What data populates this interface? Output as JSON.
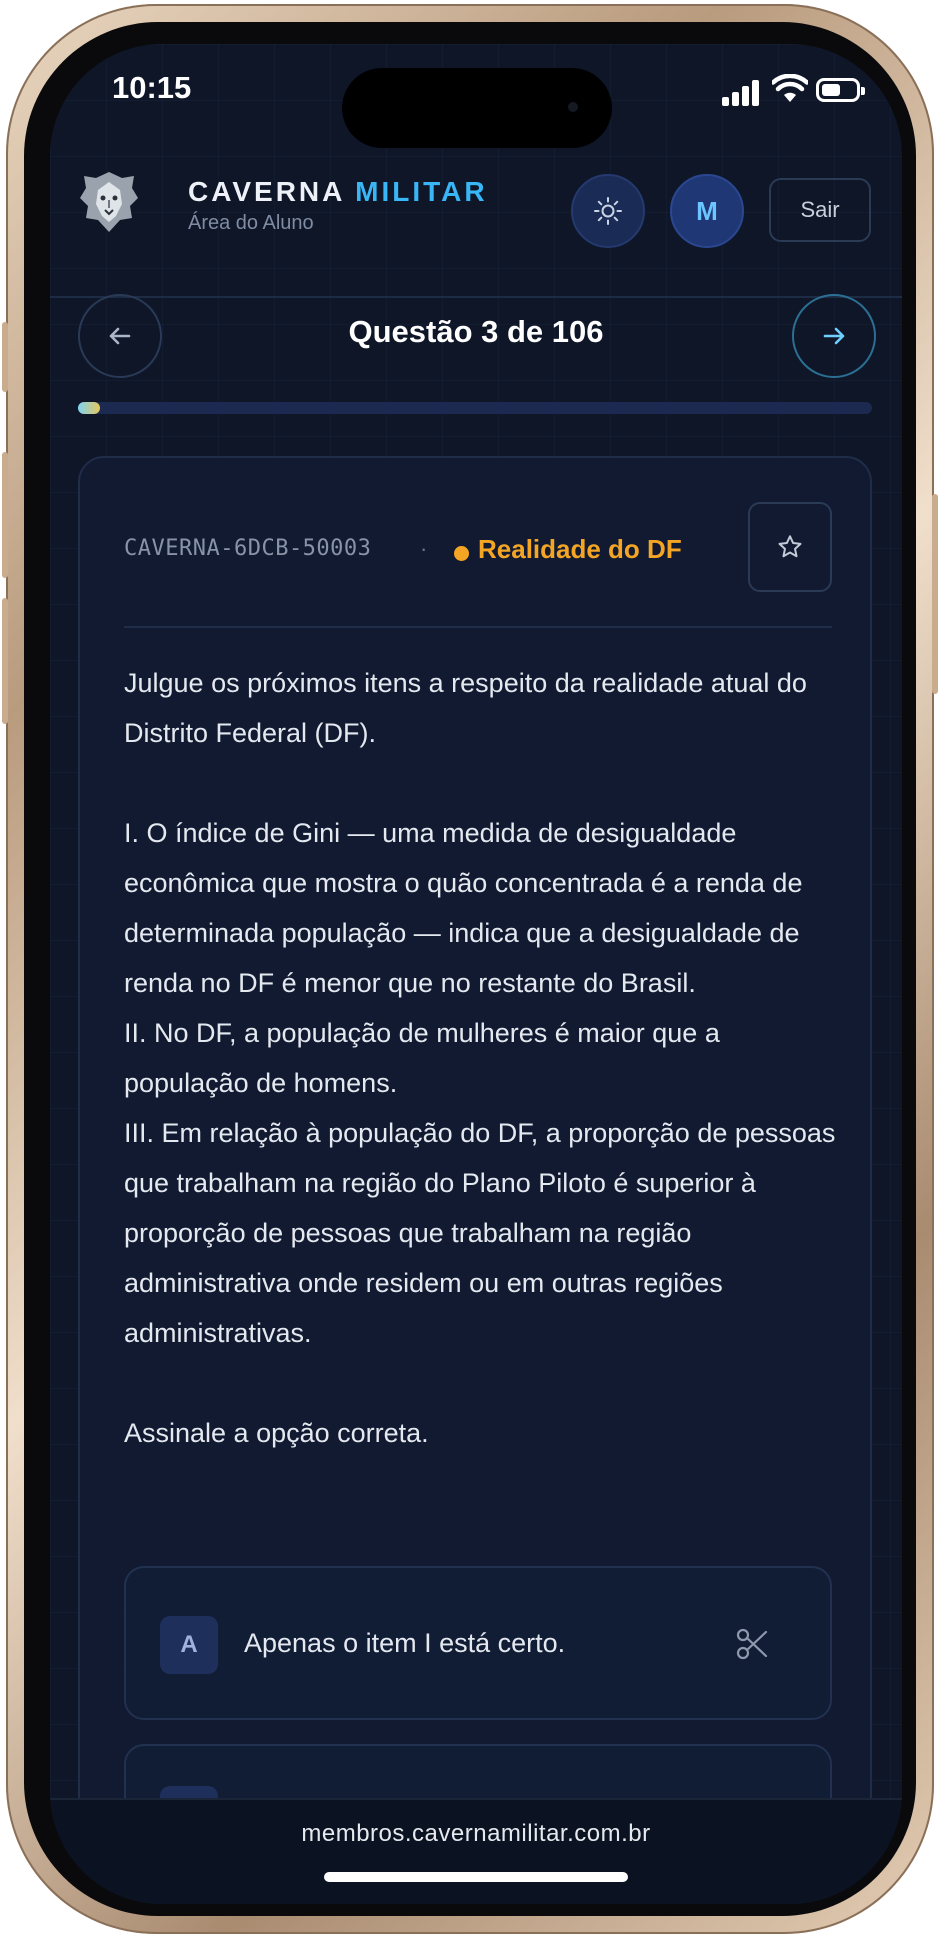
{
  "status_bar": {
    "time": "10:15"
  },
  "header": {
    "brand_part1": "CAVERNA",
    "brand_part2": "MILITAR",
    "subtitle": "Área do Aluno",
    "avatar_initial": "M",
    "logout_label": "Sair"
  },
  "navigation": {
    "counter": "Questão 3 de 106",
    "progress_fraction": 0.028
  },
  "question": {
    "code": "CAVERNA-6DCB-50003",
    "separator": "·",
    "topic": "Realidade do DF",
    "paragraphs": [
      "Julgue os próximos itens a respeito da realidade atual do Distrito Federal (DF).",
      "",
      "I. O índice de Gini — uma medida de desigualdade econômica que mostra o quão concentrada é a renda de determinada população — indica que a desigualdade de renda no DF é menor que no restante do Brasil.",
      "II. No DF, a população de mulheres é maior que a população de homens.",
      "III. Em relação à população do DF, a proporção de pessoas que trabalham na região do Plano Piloto é superior à proporção de pessoas que trabalham na região administrativa onde residem ou em outras regiões administrativas.",
      "",
      "Assinale a opção correta."
    ],
    "options": [
      {
        "letter": "A",
        "text": "Apenas o item I está certo."
      }
    ]
  },
  "browser": {
    "url": "membros.cavernamilitar.com.br"
  },
  "colors": {
    "background": "#0e1628",
    "accent_blue": "#38b6f5",
    "topic_orange": "#f5a524"
  },
  "icons": [
    "lion-logo-icon",
    "sun-icon",
    "arrow-left-icon",
    "arrow-right-icon",
    "star-icon",
    "scissors-icon"
  ]
}
